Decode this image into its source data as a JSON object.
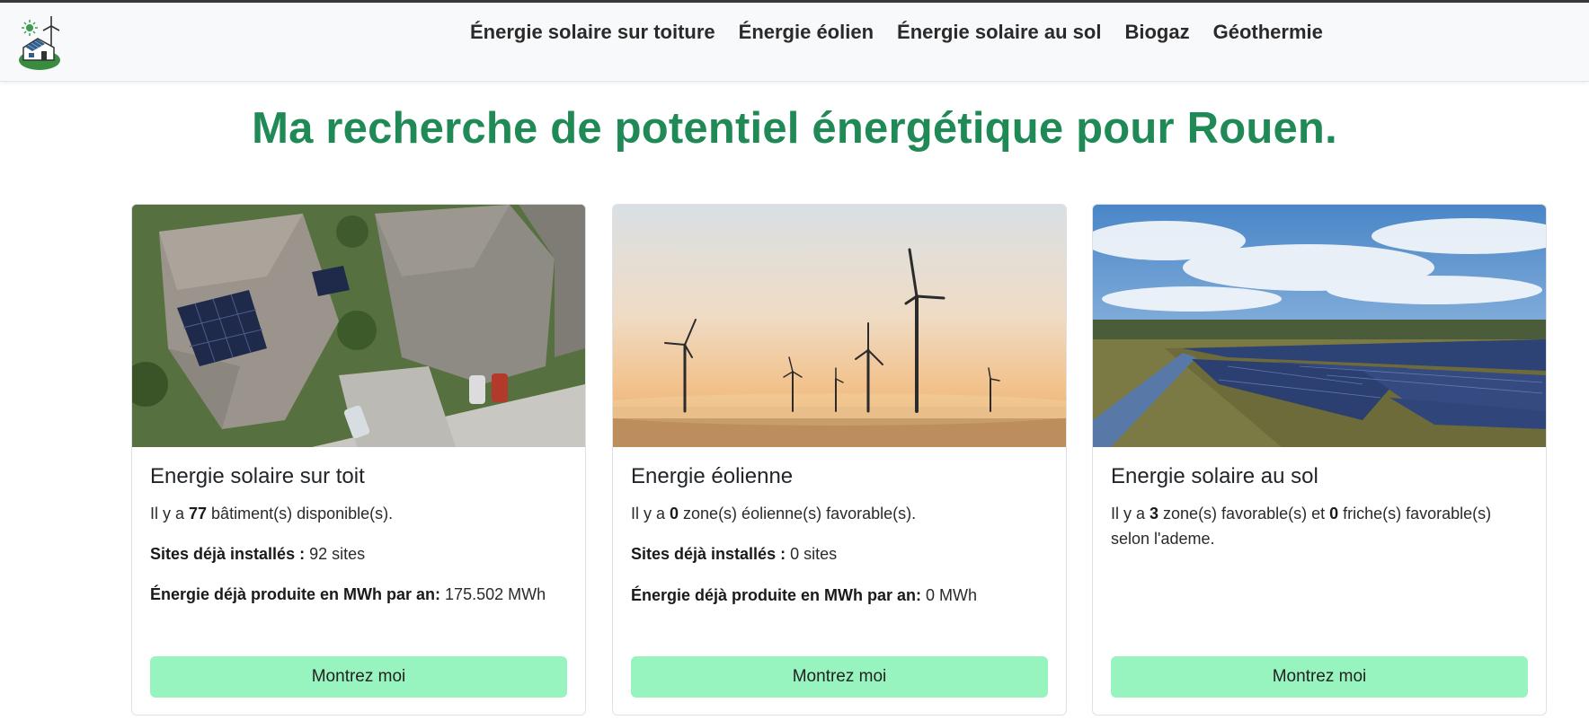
{
  "nav": {
    "links": [
      "Énergie solaire sur toiture",
      "Énergie éolien",
      "Énergie solaire au sol",
      "Biogaz",
      "Géothermie"
    ]
  },
  "page": {
    "title": "Ma recherche de potentiel énergétique pour Rouen."
  },
  "cards": [
    {
      "title": "Energie solaire sur toit",
      "text_prefix": "Il y a ",
      "count": "77",
      "text_suffix": " bâtiment(s) disponible(s).",
      "sites_label": "Sites déjà installés :",
      "sites_value": " 92 sites",
      "energy_label": "Énergie déjà produite en MWh par an:",
      "energy_value": " 175.502 MWh",
      "button": "Montrez moi"
    },
    {
      "title": "Energie éolienne",
      "text_prefix": "Il y a ",
      "count": "0",
      "text_suffix": " zone(s) éolienne(s) favorable(s).",
      "sites_label": "Sites déjà installés :",
      "sites_value": " 0 sites",
      "energy_label": "Énergie déjà produite en MWh par an:",
      "energy_value": " 0 MWh",
      "button": "Montrez moi"
    },
    {
      "title": "Energie solaire au sol",
      "text_prefix": "Il y a ",
      "count": "3",
      "text_middle": " zone(s) favorable(s) et ",
      "count2": "0",
      "text_suffix": " friche(s) favorable(s) selon l'ademe.",
      "button": "Montrez moi"
    }
  ],
  "colors": {
    "title_green": "#1f8a55",
    "button_green": "#98f4bf",
    "navbar_bg": "#f8f9fa"
  },
  "icons": {
    "logo": "house-solar-wind-logo-icon"
  }
}
